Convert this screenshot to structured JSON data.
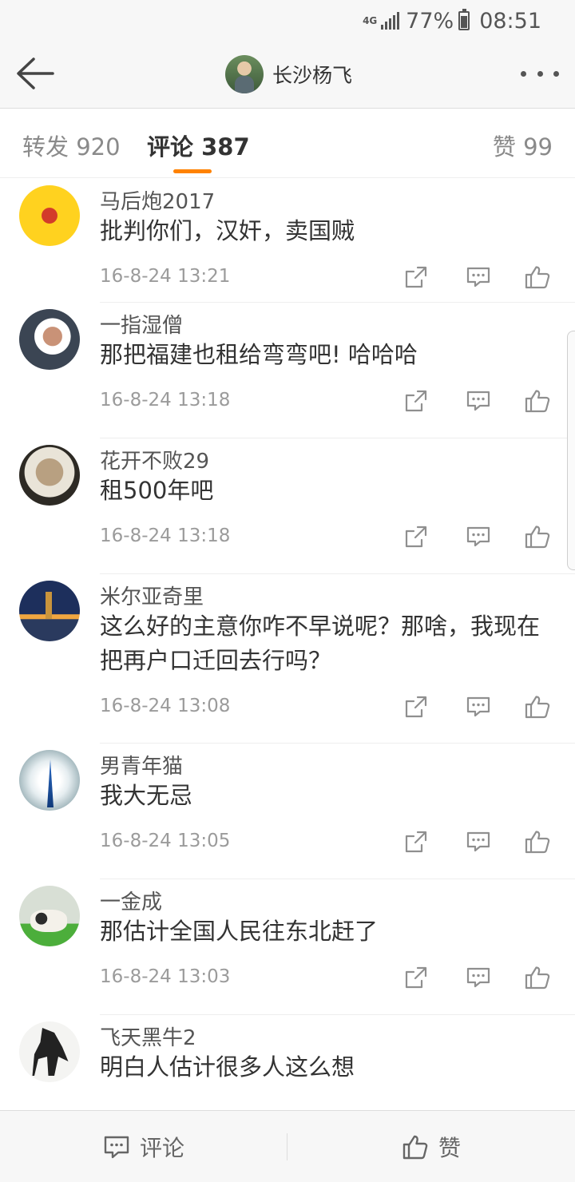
{
  "status_bar": {
    "network": "4G",
    "battery": "77%",
    "time": "08:51"
  },
  "nav": {
    "title": "长沙杨飞",
    "back_icon": "arrow-left-icon",
    "more_icon": "more-dots-icon"
  },
  "tabs": [
    {
      "label": "转发 920",
      "active": false
    },
    {
      "label": "评论 387",
      "active": true
    },
    {
      "label": "赞 99",
      "active": false
    }
  ],
  "accent_color": "#ff8200",
  "comments": [
    {
      "username": "马后炮2017",
      "text": "批判你们，汉奸，卖国贼",
      "time": "16-8-24 13:21"
    },
    {
      "username": "一指湿僧",
      "text": "那把福建也租给弯弯吧! 哈哈哈",
      "time": "16-8-24 13:18"
    },
    {
      "username": "花开不败29",
      "text": "租500年吧",
      "time": "16-8-24 13:18"
    },
    {
      "username": "米尔亚奇里",
      "text": "这么好的主意你咋不早说呢？那啥，我现在把再户口迁回去行吗？",
      "time": "16-8-24 13:08"
    },
    {
      "username": "男青年猫",
      "text": "我大无忌",
      "time": "16-8-24 13:05"
    },
    {
      "username": "一金成",
      "text": "那估计全国人民往东北赶了",
      "time": "16-8-24 13:03"
    },
    {
      "username": "飞天黑牛2",
      "text": "明白人估计很多人这么想",
      "time": ""
    }
  ],
  "bottom_bar": {
    "comment_label": "评论",
    "like_label": "赞"
  }
}
